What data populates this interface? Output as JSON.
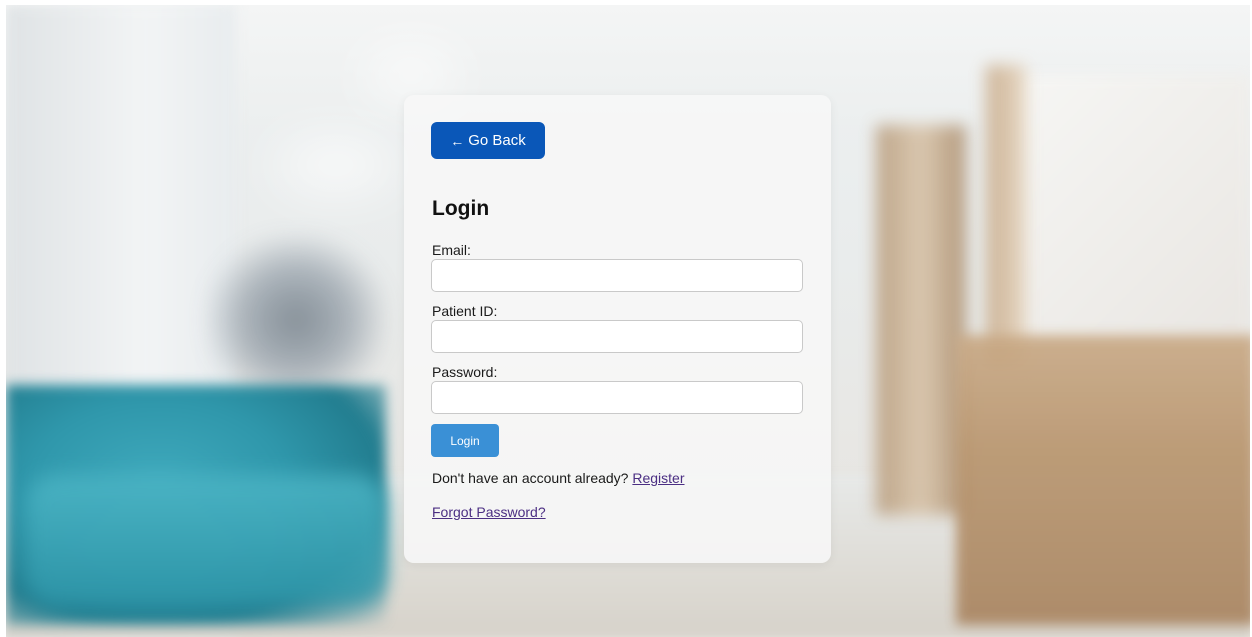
{
  "back_button": {
    "arrow": "←",
    "label": "Go Back"
  },
  "title": "Login",
  "fields": {
    "email": {
      "label": "Email:",
      "value": "",
      "placeholder": ""
    },
    "patient_id": {
      "label": "Patient ID:",
      "value": "",
      "placeholder": ""
    },
    "password": {
      "label": "Password:",
      "value": "",
      "placeholder": ""
    }
  },
  "login_button": "Login",
  "register": {
    "prompt": "Don't have an account already?",
    "link": "Register"
  },
  "forgot_password": "Forgot Password?",
  "colors": {
    "back_button": "#0a57b8",
    "login_button": "#3a90d6",
    "link": "#4b2e83"
  }
}
